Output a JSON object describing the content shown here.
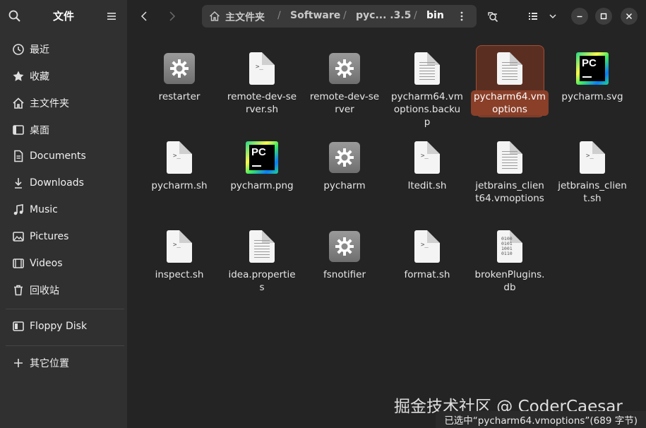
{
  "sidebar": {
    "title": "文件",
    "items": [
      {
        "label": "最近",
        "icon": "clock-icon"
      },
      {
        "label": "收藏",
        "icon": "star-icon"
      },
      {
        "label": "主文件夹",
        "icon": "home-icon"
      },
      {
        "label": "桌面",
        "icon": "desktop-icon"
      },
      {
        "label": "Documents",
        "icon": "document-icon"
      },
      {
        "label": "Downloads",
        "icon": "download-icon"
      },
      {
        "label": "Music",
        "icon": "music-icon"
      },
      {
        "label": "Pictures",
        "icon": "picture-icon"
      },
      {
        "label": "Videos",
        "icon": "video-icon"
      },
      {
        "label": "回收站",
        "icon": "trash-icon"
      }
    ],
    "devices": [
      {
        "label": "Floppy Disk",
        "icon": "disk-icon"
      }
    ],
    "other": {
      "label": "其它位置",
      "icon": "plus-icon"
    }
  },
  "path": {
    "crumbs": [
      "主文件夹",
      "Software",
      "pyc...  .3.5",
      "bin"
    ],
    "active": "bin"
  },
  "files": [
    {
      "name": "restarter",
      "type": "executable"
    },
    {
      "name": "remote-dev-server.sh",
      "type": "script"
    },
    {
      "name": "remote-dev-server",
      "type": "executable"
    },
    {
      "name": "pycharm64.vmoptions.backup",
      "type": "text"
    },
    {
      "name": "pycharm64.vmoptions",
      "type": "text",
      "selected": true
    },
    {
      "name": "pycharm.svg",
      "type": "pycharm"
    },
    {
      "name": "pycharm.sh",
      "type": "script"
    },
    {
      "name": "pycharm.png",
      "type": "pycharm"
    },
    {
      "name": "pycharm",
      "type": "executable"
    },
    {
      "name": "ltedit.sh",
      "type": "script"
    },
    {
      "name": "jetbrains_client64.vmoptions",
      "type": "text"
    },
    {
      "name": "jetbrains_client.sh",
      "type": "script"
    },
    {
      "name": "inspect.sh",
      "type": "script"
    },
    {
      "name": "idea.properties",
      "type": "text"
    },
    {
      "name": "fsnotifier",
      "type": "executable"
    },
    {
      "name": "format.sh",
      "type": "script"
    },
    {
      "name": "brokenPlugins.db",
      "type": "binary"
    }
  ],
  "watermark": "掘金技术社区 @ CoderCaesar",
  "status": "已选中“pycharm64.vmoptions”(689 字节)",
  "colors": {
    "accent": "#8a3f29",
    "sidebar": "#303030",
    "background": "#242424"
  }
}
